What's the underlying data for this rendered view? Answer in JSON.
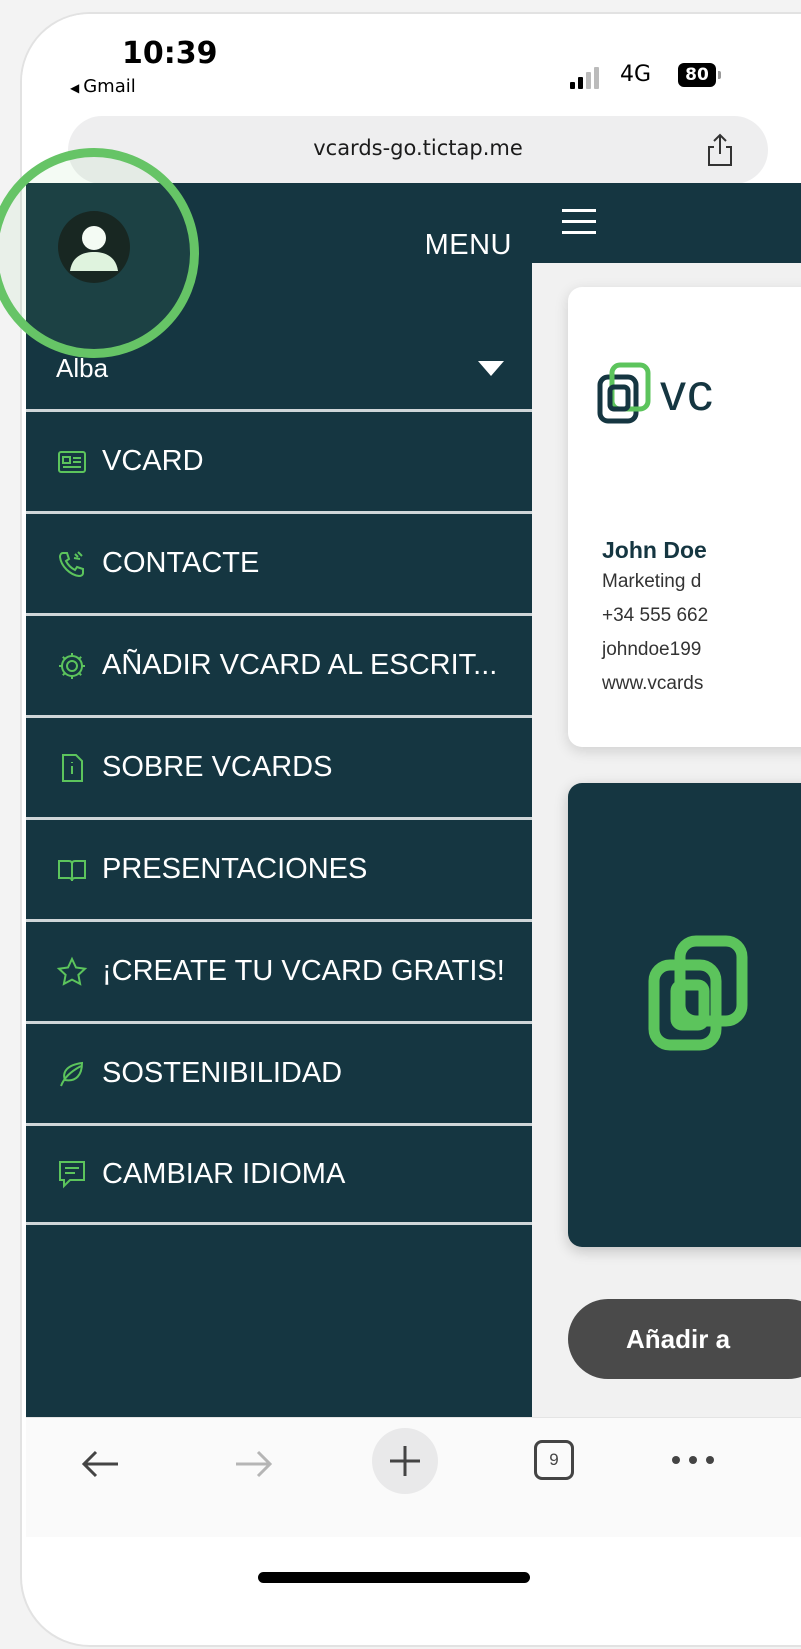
{
  "status_bar": {
    "time": "10:39",
    "back_app": "Gmail",
    "network": "4G",
    "battery": "80"
  },
  "browser": {
    "url": "vcards-go.tictap.me",
    "tab_count": "9"
  },
  "sidebar": {
    "menu_label": "MENU",
    "user_name": "Alba",
    "items": [
      {
        "label": "VCARD",
        "icon": "id-card-icon"
      },
      {
        "label": "CONTACTE",
        "icon": "phone-icon"
      },
      {
        "label": "AÑADIR VCARD AL ESCRIT...",
        "icon": "gear-icon"
      },
      {
        "label": "SOBRE VCARDS",
        "icon": "info-document-icon"
      },
      {
        "label": "PRESENTACIONES",
        "icon": "book-icon"
      },
      {
        "label": "¡CREATE TU VCARD GRATIS!",
        "icon": "star-icon"
      },
      {
        "label": "SOSTENIBILIDAD",
        "icon": "leaf-icon"
      },
      {
        "label": "CAMBIAR IDIOMA",
        "icon": "chat-icon"
      }
    ]
  },
  "main": {
    "logo_text": "vc",
    "contact": {
      "name": "John Doe",
      "title": "Marketing d",
      "phone": "+34 555 662",
      "email": "johndoe199",
      "web": "www.vcards"
    },
    "add_button": "Añadir a"
  },
  "colors": {
    "sidebar_bg": "#153641",
    "accent_green": "#66c466",
    "divider": "#cfd6d8"
  }
}
